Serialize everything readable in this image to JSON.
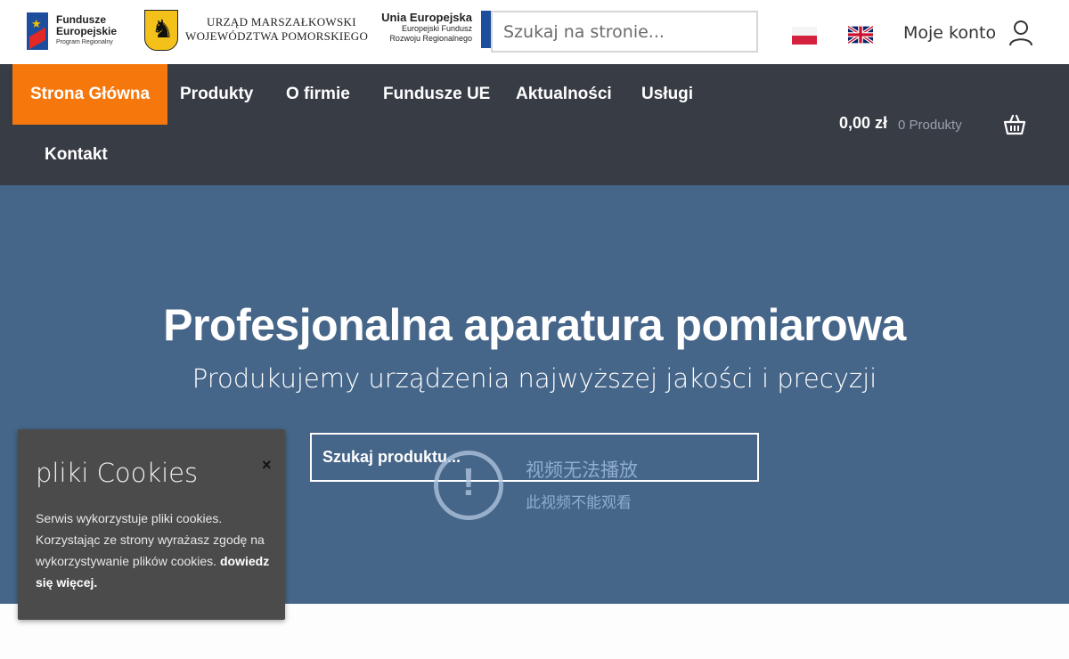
{
  "header": {
    "logos": {
      "fundusze": {
        "line1": "Fundusze",
        "line2": "Europejskie",
        "line3": "Program Regionalny"
      },
      "urzad": {
        "line1": "URZĄD MARSZAŁKOWSKI",
        "line2": "WOJEWÓDZTWA POMORSKIEGO"
      },
      "unia": {
        "line1": "Unia Europejska",
        "line2": "Europejski Fundusz",
        "line3": "Rozwoju Regionalnego"
      }
    },
    "search_placeholder": "Szukaj na stronie...",
    "languages": [
      "pl",
      "en"
    ],
    "account_label": "Moje konto"
  },
  "nav": {
    "items": [
      {
        "label": "Strona Główna",
        "active": true
      },
      {
        "label": "Produkty"
      },
      {
        "label": "O firmie"
      },
      {
        "label": "Fundusze UE"
      },
      {
        "label": "Aktualności"
      },
      {
        "label": "Usługi"
      },
      {
        "label": "Kontakt"
      }
    ],
    "cart": {
      "total": "0,00 zł",
      "count": "0 Produkty"
    }
  },
  "hero": {
    "title": "Profesjonalna aparatura pomiarowa",
    "subtitle": "Produkujemy urządzenia najwyższej jakości i precyzji",
    "search_placeholder": "Szukaj produktu...",
    "video_error": {
      "title": "视频无法播放",
      "message": "此视频不能观看"
    }
  },
  "cookies": {
    "title": "pliki Cookies",
    "close": "×",
    "text": "Serwis wykorzystuje pliki cookies. Korzystając ze strony wyrażasz zgodę na wykorzystywanie plików cookies.",
    "more": "dowiedz się więcej."
  },
  "colors": {
    "accent": "#f6780d",
    "navbar": "#383c45",
    "hero": "#456589",
    "cookie_bg": "#4b4b4b"
  }
}
